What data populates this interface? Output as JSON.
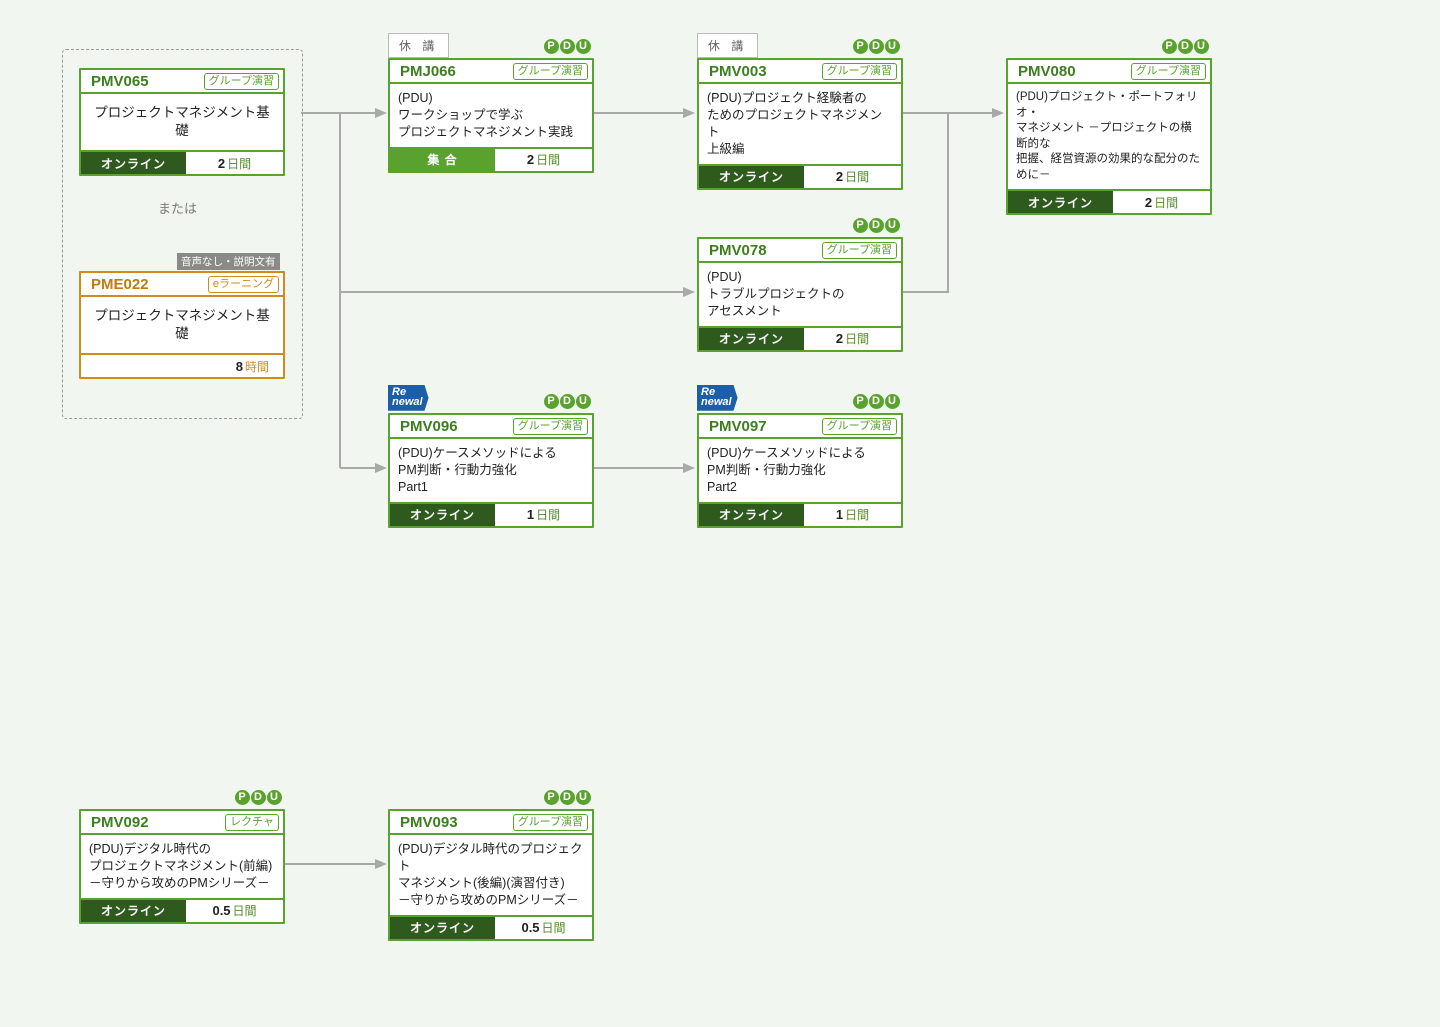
{
  "labels": {
    "or": "または",
    "cancel": "休 講",
    "note_audio": "音声なし・説明文有"
  },
  "cards": {
    "pmv065": {
      "code": "PMV065",
      "tag": "グループ演習",
      "title": "プロジェクトマネジメント基礎",
      "mode": "オンライン",
      "durNum": "2",
      "durUnit": "日間"
    },
    "pme022": {
      "code": "PME022",
      "tag": "eラーニング",
      "title": "プロジェクトマネジメント基礎",
      "durNum": "8",
      "durUnit": "時間"
    },
    "pmj066": {
      "code": "PMJ066",
      "tag": "グループ演習",
      "title": "(PDU)\nワークショップで学ぶ\nプロジェクトマネジメント実践",
      "mode": "集 合",
      "durNum": "2",
      "durUnit": "日間"
    },
    "pmv003": {
      "code": "PMV003",
      "tag": "グループ演習",
      "title": "(PDU)プロジェクト経験者の\nためのプロジェクトマネジメント\n上級編",
      "mode": "オンライン",
      "durNum": "2",
      "durUnit": "日間"
    },
    "pmv080": {
      "code": "PMV080",
      "tag": "グループ演習",
      "title": "(PDU)プロジェクト・ポートフォリオ・\nマネジメント －プロジェクトの横断的な\n把握、経営資源の効果的な配分のために－",
      "mode": "オンライン",
      "durNum": "2",
      "durUnit": "日間"
    },
    "pmv078": {
      "code": "PMV078",
      "tag": "グループ演習",
      "title": "(PDU)\nトラブルプロジェクトの\nアセスメント",
      "mode": "オンライン",
      "durNum": "2",
      "durUnit": "日間"
    },
    "pmv096": {
      "code": "PMV096",
      "tag": "グループ演習",
      "title": "(PDU)ケースメソッドによる\nPM判断・行動力強化\nPart1",
      "mode": "オンライン",
      "durNum": "1",
      "durUnit": "日間"
    },
    "pmv097": {
      "code": "PMV097",
      "tag": "グループ演習",
      "title": "(PDU)ケースメソッドによる\nPM判断・行動力強化\nPart2",
      "mode": "オンライン",
      "durNum": "1",
      "durUnit": "日間"
    },
    "pmv092": {
      "code": "PMV092",
      "tag": "レクチャ",
      "title": "(PDU)デジタル時代の\nプロジェクトマネジメント(前編)\n－守りから攻めのPMシリーズ－",
      "mode": "オンライン",
      "durNum": "0.5",
      "durUnit": "日間"
    },
    "pmv093": {
      "code": "PMV093",
      "tag": "グループ演習",
      "title": "(PDU)デジタル時代のプロジェクト\nマネジメント(後編)(演習付き)\n－守りから攻めのPMシリーズ－",
      "mode": "オンライン",
      "durNum": "0.5",
      "durUnit": "日間"
    }
  }
}
